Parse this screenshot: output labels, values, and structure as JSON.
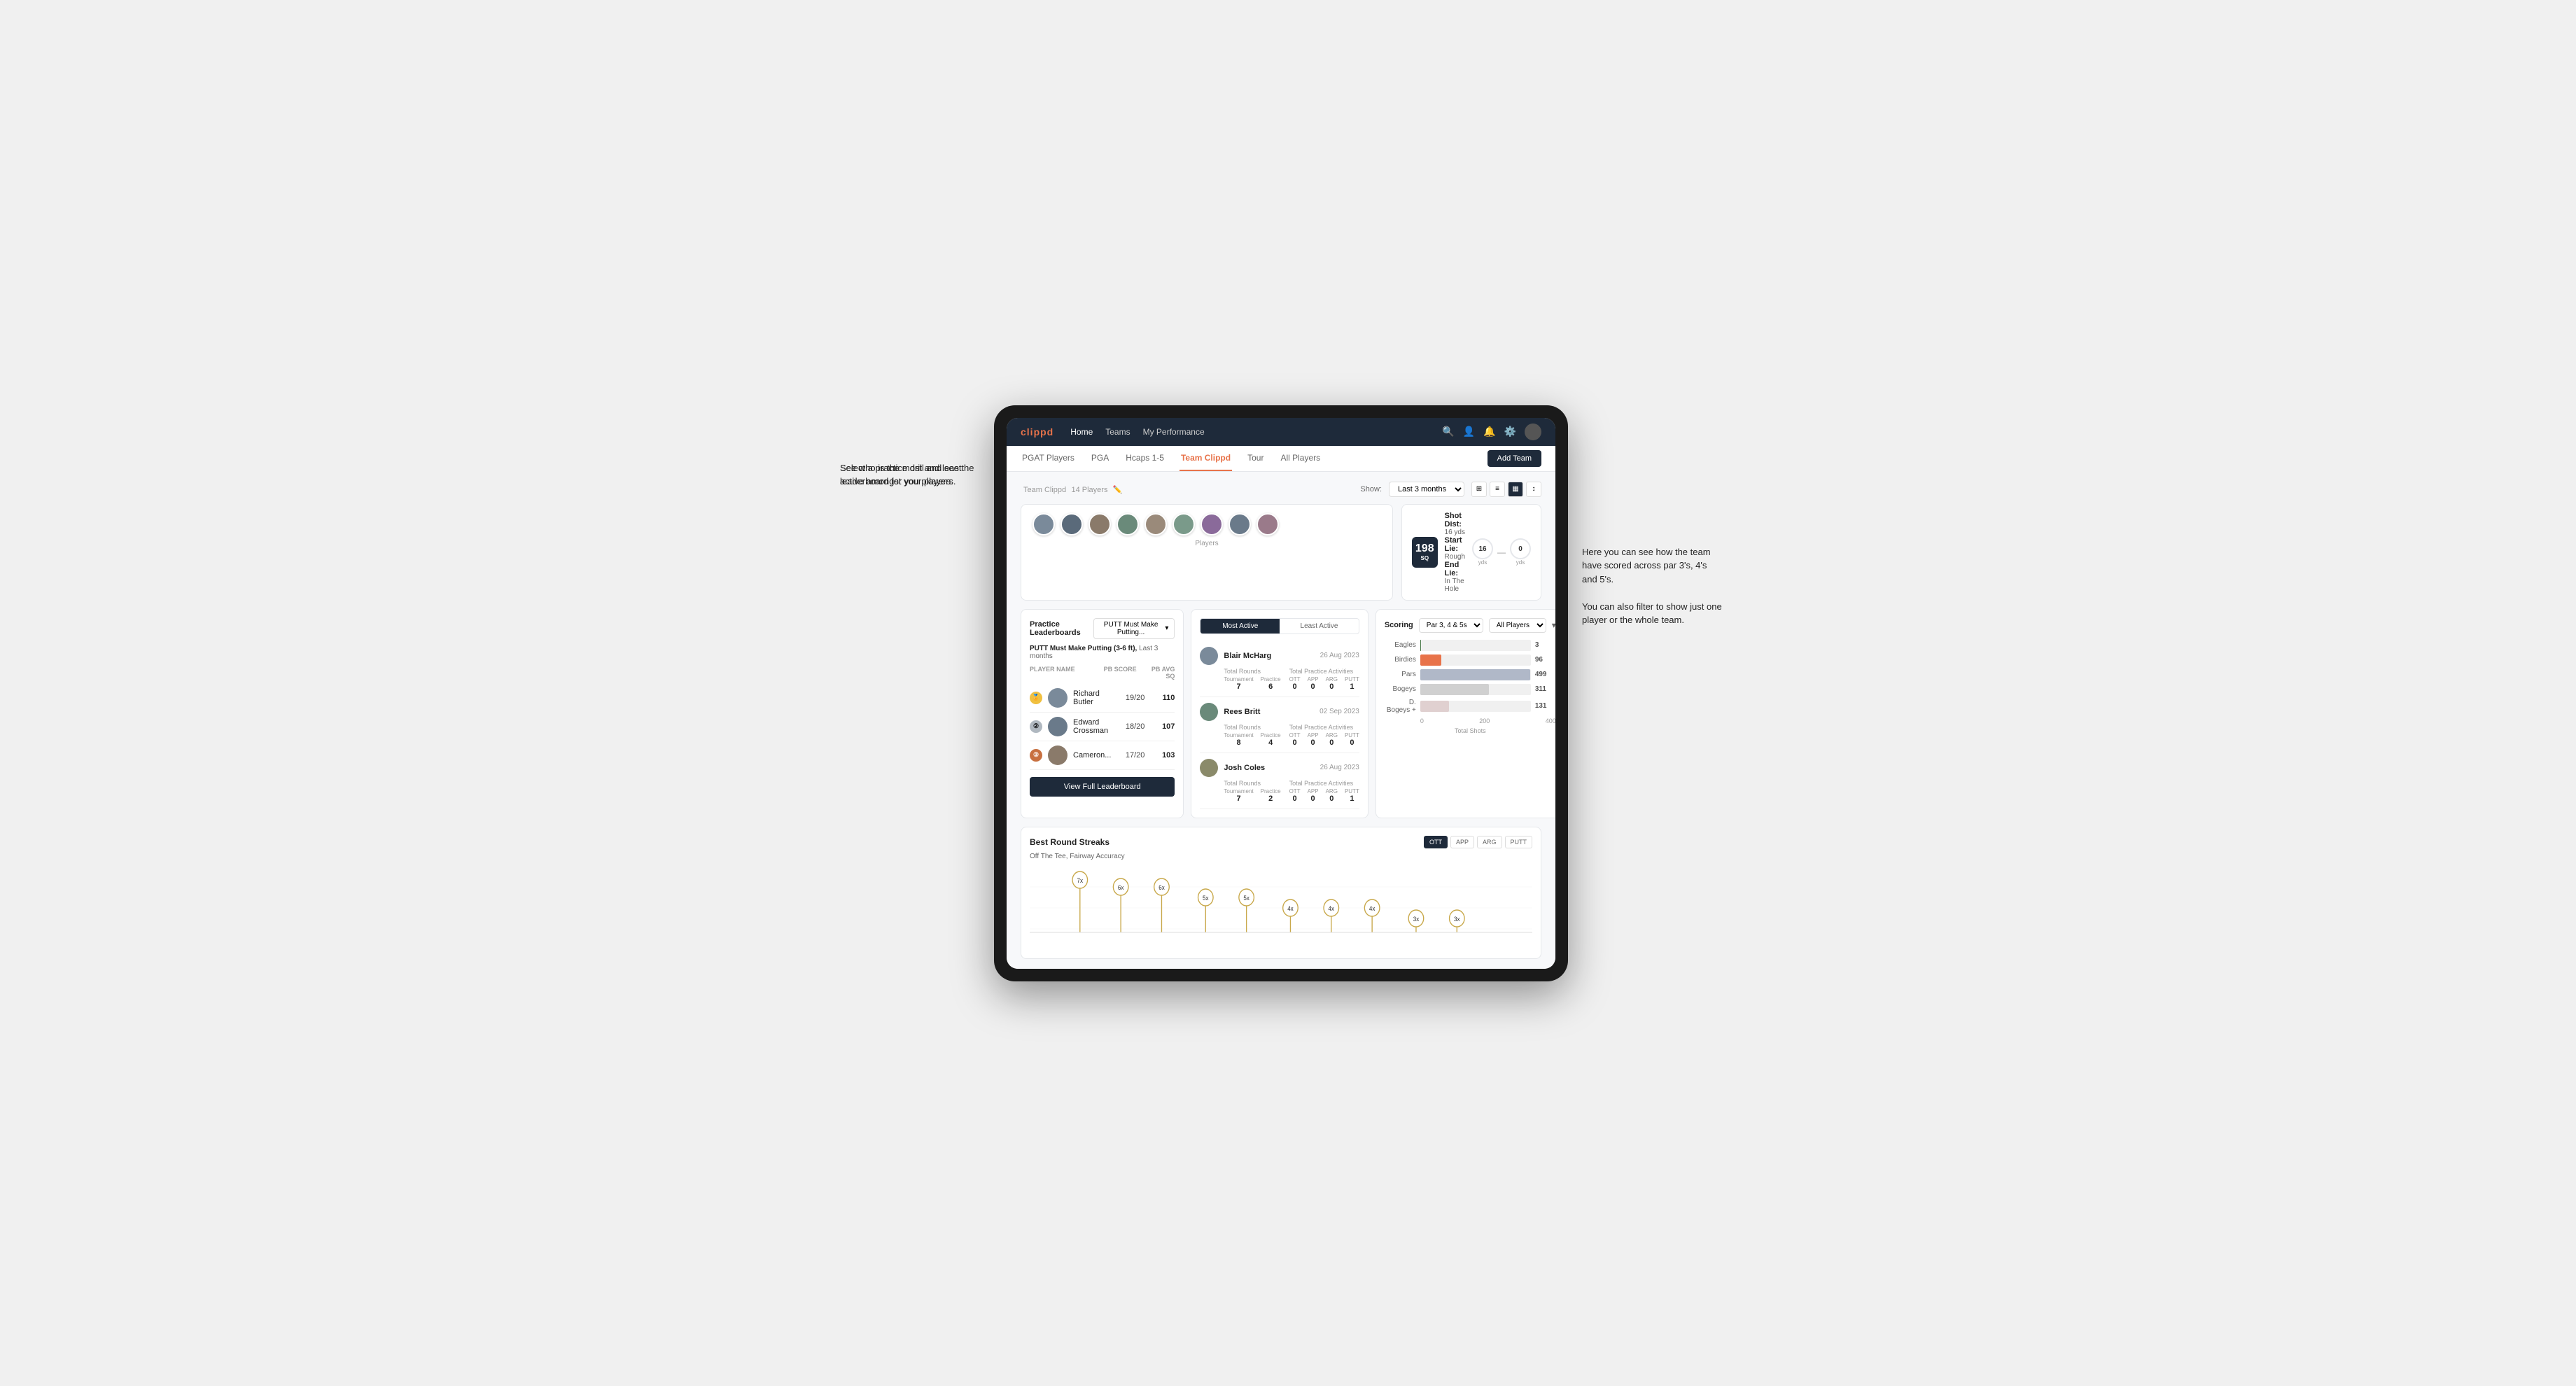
{
  "annotations": {
    "left1": "Select a practice drill and see the leaderboard for you players.",
    "left2": "See who is the most and least active amongst your players.",
    "right": "Here you can see how the team have scored across par 3's, 4's and 5's.\n\nYou can also filter to show just one player or the whole team."
  },
  "navbar": {
    "brand": "clippd",
    "links": [
      "Home",
      "Teams",
      "My Performance"
    ],
    "icons": [
      "search",
      "person",
      "bell",
      "settings",
      "avatar"
    ]
  },
  "subnav": {
    "items": [
      "PGAT Players",
      "PGA",
      "Hcaps 1-5",
      "Team Clippd",
      "Tour",
      "All Players"
    ],
    "active": "Team Clippd",
    "add_button": "Add Team"
  },
  "team": {
    "title": "Team Clippd",
    "player_count": "14 Players",
    "show_label": "Show:",
    "show_value": "Last 3 months",
    "players_label": "Players",
    "player_count_num": 9
  },
  "shot_info": {
    "badge": "198",
    "badge_sub": "SQ",
    "dist_label": "Shot Dist:",
    "dist_value": "16 yds",
    "start_label": "Start Lie:",
    "start_value": "Rough",
    "end_label": "End Lie:",
    "end_value": "In The Hole",
    "circle1_val": "16",
    "circle1_unit": "yds",
    "circle2_val": "0",
    "circle2_unit": "yds"
  },
  "leaderboard": {
    "title": "Practice Leaderboards",
    "dropdown": "PUTT Must Make Putting...",
    "subtitle": "PUTT Must Make Putting (3-6 ft),",
    "subtitle_period": "Last 3 months",
    "table_headers": [
      "PLAYER NAME",
      "PB SCORE",
      "PB AVG SQ"
    ],
    "players": [
      {
        "rank": 1,
        "rank_type": "gold",
        "name": "Richard Butler",
        "score": "19/20",
        "avg": "110"
      },
      {
        "rank": 2,
        "rank_type": "silver",
        "name": "Edward Crossman",
        "score": "18/20",
        "avg": "107"
      },
      {
        "rank": 3,
        "rank_type": "bronze",
        "name": "Cameron...",
        "score": "17/20",
        "avg": "103"
      }
    ],
    "view_full_btn": "View Full Leaderboard"
  },
  "activity": {
    "toggle_options": [
      "Most Active",
      "Least Active"
    ],
    "active_toggle": "Most Active",
    "players": [
      {
        "name": "Blair McHarg",
        "date": "26 Aug 2023",
        "total_rounds_label": "Total Rounds",
        "tournament": "7",
        "practice": "6",
        "total_practice_label": "Total Practice Activities",
        "ott": "0",
        "app": "0",
        "arg": "0",
        "putt": "1"
      },
      {
        "name": "Rees Britt",
        "date": "02 Sep 2023",
        "total_rounds_label": "Total Rounds",
        "tournament": "8",
        "practice": "4",
        "total_practice_label": "Total Practice Activities",
        "ott": "0",
        "app": "0",
        "arg": "0",
        "putt": "0"
      },
      {
        "name": "Josh Coles",
        "date": "26 Aug 2023",
        "total_rounds_label": "Total Rounds",
        "tournament": "7",
        "practice": "2",
        "total_practice_label": "Total Practice Activities",
        "ott": "0",
        "app": "0",
        "arg": "0",
        "putt": "1"
      }
    ]
  },
  "scoring": {
    "title": "Scoring",
    "par_filter": "Par 3, 4 & 5s",
    "player_filter": "All Players",
    "bars": [
      {
        "label": "Eagles",
        "value": 3,
        "max": 500,
        "type": "eagles"
      },
      {
        "label": "Birdies",
        "value": 96,
        "max": 500,
        "type": "birdies"
      },
      {
        "label": "Pars",
        "value": 499,
        "max": 500,
        "type": "pars"
      },
      {
        "label": "Bogeys",
        "value": 311,
        "max": 500,
        "type": "bogeys"
      },
      {
        "label": "D. Bogeys +",
        "value": 131,
        "max": 500,
        "type": "dbogeys"
      }
    ],
    "axis_labels": [
      "0",
      "200",
      "400"
    ],
    "footer": "Total Shots"
  },
  "streaks": {
    "title": "Best Round Streaks",
    "subtitle": "Off The Tee, Fairway Accuracy",
    "filters": [
      "OTT",
      "APP",
      "ARG",
      "PUTT"
    ],
    "active_filter": "OTT",
    "data_points": [
      {
        "x": 10,
        "label": "7x"
      },
      {
        "x": 18,
        "label": "6x"
      },
      {
        "x": 26,
        "label": "6x"
      },
      {
        "x": 35,
        "label": "5x"
      },
      {
        "x": 43,
        "label": "5x"
      },
      {
        "x": 52,
        "label": "4x"
      },
      {
        "x": 60,
        "label": "4x"
      },
      {
        "x": 68,
        "label": "4x"
      },
      {
        "x": 77,
        "label": "3x"
      },
      {
        "x": 85,
        "label": "3x"
      }
    ]
  }
}
